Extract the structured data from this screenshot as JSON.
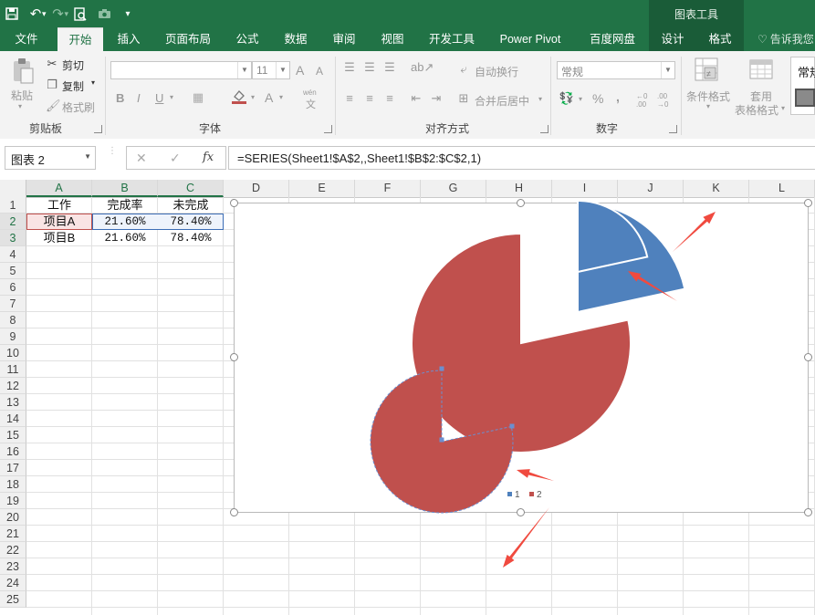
{
  "qat": {
    "save_icon": "save-icon",
    "undo_icon": "undo-icon",
    "redo_icon": "redo-icon",
    "preview_icon": "print-preview-icon",
    "camera_icon": "camera-icon",
    "customize_icon": "customize-icon"
  },
  "contextual": {
    "header": "图表工具"
  },
  "tabs": [
    {
      "label": "文件"
    },
    {
      "label": "开始"
    },
    {
      "label": "插入"
    },
    {
      "label": "页面布局"
    },
    {
      "label": "公式"
    },
    {
      "label": "数据"
    },
    {
      "label": "审阅"
    },
    {
      "label": "视图"
    },
    {
      "label": "开发工具"
    },
    {
      "label": "Power Pivot"
    },
    {
      "label": "百度网盘"
    },
    {
      "label": "设计"
    },
    {
      "label": "格式"
    }
  ],
  "tell_me": "告诉我您",
  "ribbon": {
    "clipboard": {
      "paste": "粘贴",
      "cut": "剪切",
      "copy": "复制",
      "format_painter": "格式刷",
      "label": "剪贴板"
    },
    "font": {
      "font_name": "",
      "font_size": "11",
      "bold": "B",
      "italic": "I",
      "underline": "U",
      "grow": "A",
      "shrink": "A",
      "font_color": "A",
      "wen": "wén",
      "wen2": "文",
      "label": "字体"
    },
    "alignment": {
      "wrap": "自动换行",
      "merge": "合并后居中",
      "label": "对齐方式"
    },
    "number": {
      "format": "常规",
      "percent": "%",
      "comma": ",",
      "inc_dec": "←0 .00",
      "dec_dec": ".00 →0",
      "label": "数字"
    },
    "styles": {
      "conditional": "条件格式",
      "table_format1": "套用",
      "table_format2": "表格格式",
      "cell_styles": "常规"
    }
  },
  "formula_bar": {
    "name_box": "图表 2",
    "cancel": "✕",
    "enter": "✓",
    "fx": "fx",
    "formula": "=SERIES(Sheet1!$A$2,,Sheet1!$B$2:$C$2,1)"
  },
  "columns": [
    "A",
    "B",
    "C",
    "D",
    "E",
    "F",
    "G",
    "H",
    "I",
    "J",
    "K",
    "L"
  ],
  "rows": [
    "1",
    "2",
    "3",
    "4",
    "5",
    "6",
    "7",
    "8",
    "9",
    "10",
    "11",
    "12",
    "13",
    "14",
    "15",
    "16",
    "17",
    "18",
    "19",
    "20",
    "21",
    "22",
    "23",
    "24",
    "25"
  ],
  "cells": {
    "header": [
      "工作",
      "完成率",
      "未完成"
    ],
    "row2": [
      "项目A",
      "21.60%",
      "78.40%"
    ],
    "row3": [
      "项目B",
      "21.60%",
      "78.40%"
    ]
  },
  "colors": {
    "excel_green": "#217346",
    "blue_slice": "#4f81bd",
    "red_slice": "#c0504d",
    "arrow": "#f04a3f"
  },
  "chart_data": {
    "type": "pie",
    "categories": [
      "1",
      "2"
    ],
    "series": [
      {
        "values": [
          21.6,
          78.4
        ]
      },
      {
        "values": [
          21.6,
          78.4
        ]
      }
    ],
    "legend": "bottom",
    "legend_entries": [
      "1",
      "2"
    ],
    "colors": [
      "#4f81bd",
      "#c0504d"
    ]
  }
}
